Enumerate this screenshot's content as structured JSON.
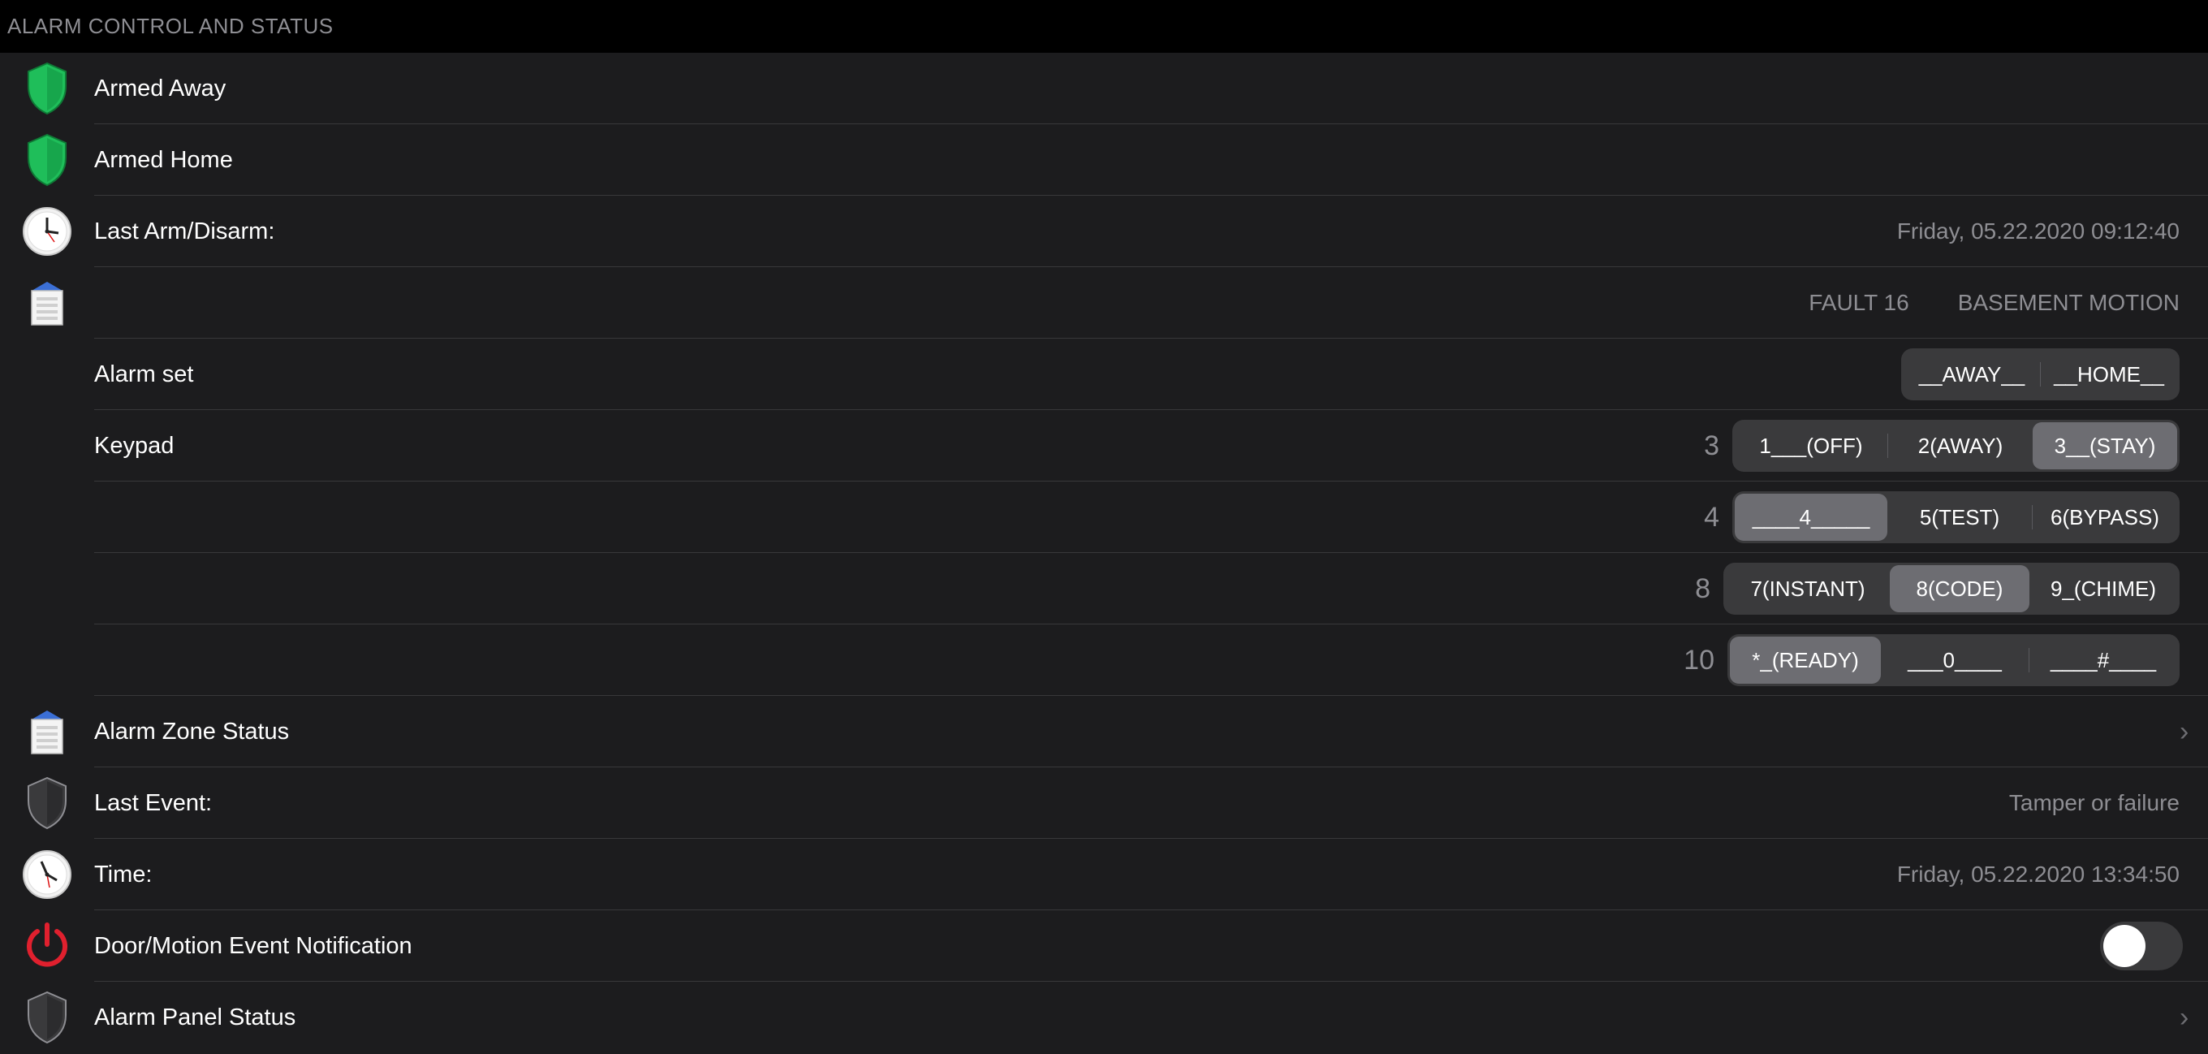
{
  "header": {
    "title": "ALARM CONTROL AND STATUS"
  },
  "rows": {
    "armed_away": {
      "label": "Armed Away",
      "icon": "shield-green-icon"
    },
    "armed_home": {
      "label": "Armed Home",
      "icon": "shield-green-icon"
    },
    "last_arm": {
      "label": "Last Arm/Disarm:",
      "value": "Friday, 05.22.2020 09:12:40",
      "icon": "clock-icon"
    },
    "fault": {
      "values": [
        "FAULT 16",
        "BASEMENT MOTION"
      ],
      "icon": "alarm-panel-icon"
    },
    "alarm_set": {
      "label": "Alarm set",
      "options": [
        "__AWAY__",
        "__HOME__"
      ]
    },
    "keypad": {
      "label": "Keypad",
      "rows": [
        {
          "value": "3",
          "options": [
            "1___(OFF)",
            "2(AWAY)",
            "3__(STAY)"
          ],
          "selected": 2
        },
        {
          "value": "4",
          "options": [
            "____4_____",
            "5(TEST)",
            "6(BYPASS)"
          ],
          "selected": 0
        },
        {
          "value": "8",
          "options": [
            "7(INSTANT)",
            "8(CODE)",
            "9_(CHIME)"
          ],
          "selected": 1
        },
        {
          "value": "10",
          "options": [
            "*_(READY)",
            "___0____",
            "____#____"
          ],
          "selected": 0
        }
      ]
    },
    "zone_status": {
      "label": "Alarm Zone Status",
      "icon": "alarm-panel-icon"
    },
    "last_event": {
      "label": "Last Event:",
      "value": "Tamper or failure",
      "icon": "shield-gray-icon"
    },
    "time": {
      "label": "Time:",
      "value": "Friday, 05.22.2020 13:34:50",
      "icon": "clock-icon"
    },
    "notification": {
      "label": "Door/Motion Event Notification",
      "toggle_on": false,
      "icon": "power-icon"
    },
    "panel_status": {
      "label": "Alarm Panel Status",
      "icon": "shield-gray-icon"
    }
  },
  "colors": {
    "background": "#1c1c1e",
    "header": "#000000",
    "shield_green": "#1fbe5a",
    "shield_gray": "#3a3a3c",
    "power_red": "#e0202e",
    "secondary_text": "#8e8e93",
    "segment_bg": "#3a3a3c",
    "segment_selected": "#6d6d72"
  }
}
